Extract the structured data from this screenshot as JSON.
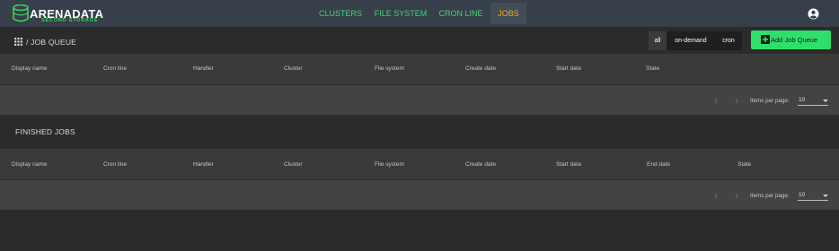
{
  "header": {
    "logo_text": "ARENADATA",
    "logo_subtitle": "SECOND STORAGE",
    "nav": [
      {
        "label": "CLUSTERS",
        "active": false
      },
      {
        "label": "FILE SYSTEM",
        "active": false
      },
      {
        "label": "CRON LINE",
        "active": false
      },
      {
        "label": "JOBS",
        "active": true
      }
    ],
    "account_icon": "account-circle-icon"
  },
  "job_queue": {
    "title": "/ JOB QUEUE",
    "filters": [
      "all",
      "on-demand",
      "cron"
    ],
    "selected_filter": "all",
    "add_button_label": "Add Job Queue",
    "columns": [
      "Display name",
      "Cron line",
      "Handler",
      "Cluster",
      "File system",
      "Create date",
      "Start date",
      "State"
    ],
    "rows": [],
    "pagination": {
      "items_per_page_label": "Items per page:",
      "items_per_page": "10"
    }
  },
  "finished_jobs": {
    "title": "FINISHED JOBS",
    "columns": [
      "Display name",
      "Cron line",
      "Handler",
      "Cluster",
      "File system",
      "Create date",
      "Start date",
      "End date",
      "State"
    ],
    "rows": [],
    "pagination": {
      "items_per_page_label": "Items per page:",
      "items_per_page": "10"
    }
  },
  "colors": {
    "topbar": "#363f4a",
    "nav_link": "#47d37a",
    "nav_active": "#f5a623",
    "add_button": "#2ee06b"
  }
}
